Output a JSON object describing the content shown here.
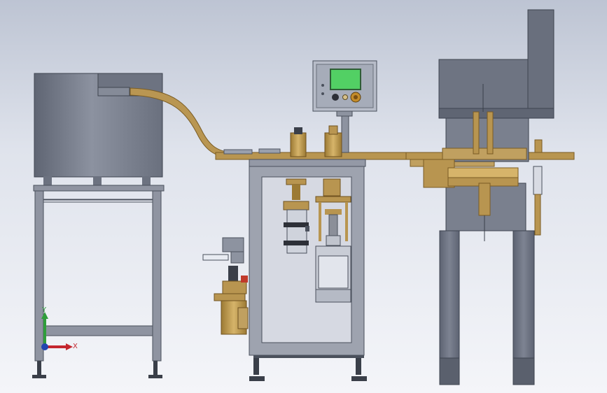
{
  "triad": {
    "x_label": "X",
    "y_label": "Y"
  },
  "colors": {
    "steel": "#7b8190",
    "steel_dark": "#565d6c",
    "frame": "#8e93a0",
    "brass": "#c4a058",
    "brass_dark": "#8c6a2c",
    "screen": "#52d064"
  }
}
